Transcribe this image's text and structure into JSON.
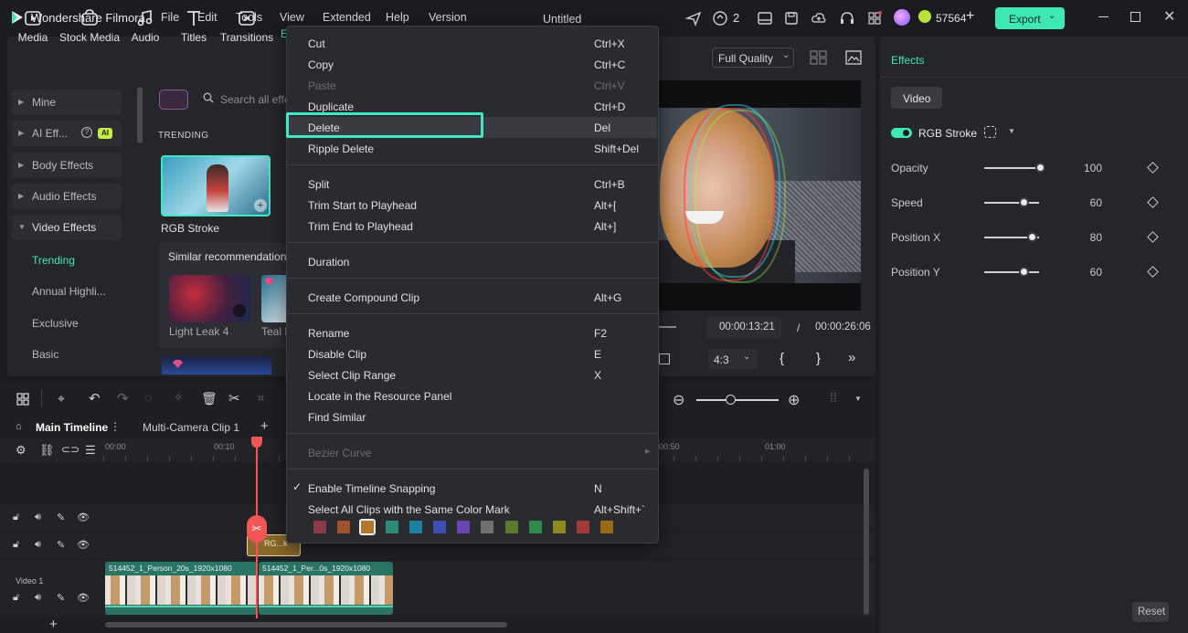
{
  "app": {
    "name": "Wondershare Filmora",
    "project_title": "Untitled",
    "menus": [
      "File",
      "Edit",
      "Tools",
      "View",
      "Extended",
      "Help",
      "Version"
    ],
    "notifications_count": "2",
    "credits": "57564",
    "export_label": "Export"
  },
  "toolbar": {
    "tabs": [
      "Media",
      "Stock Media",
      "Audio",
      "Titles",
      "Transitions",
      "E"
    ]
  },
  "sidebar": {
    "categories": [
      {
        "label": "Mine"
      },
      {
        "label": "AI Eff...",
        "badge": "AI"
      },
      {
        "label": "Body Effects"
      },
      {
        "label": "Audio Effects"
      },
      {
        "label": "Video Effects"
      }
    ],
    "subitems": [
      "Trending",
      "Annual Highli...",
      "Exclusive",
      "Basic"
    ]
  },
  "library": {
    "search_placeholder": "Search all effe",
    "section_title": "TRENDING",
    "featured_label": "RGB Stroke",
    "similar_title": "Similar recommendations",
    "similar_items": [
      "Light Leak 4",
      "Teal F"
    ]
  },
  "preview": {
    "quality": "Full Quality",
    "current_time": "00:00:13:21",
    "separator": "/",
    "total_time": "00:00:26:06",
    "aspect": "4:3"
  },
  "effects_panel": {
    "title": "Effects",
    "tab": "Video",
    "effect_name": "RGB Stroke",
    "params": [
      {
        "label": "Opacity",
        "value": "100",
        "fraction": 1.0
      },
      {
        "label": "Speed",
        "value": "60",
        "fraction": 0.6
      },
      {
        "label": "Position X",
        "value": "80",
        "fraction": 0.8
      },
      {
        "label": "Position Y",
        "value": "60",
        "fraction": 0.6
      }
    ],
    "reset_label": "Reset"
  },
  "timeline": {
    "tabs": [
      "Main Timeline",
      "Multi-Camera Clip 1"
    ],
    "ruler": [
      "00:00",
      "00:10",
      "00:50",
      "01:00"
    ],
    "track_label": "Video 1",
    "effect_clip": "RG...k",
    "clips": [
      "514452_1_Person_20s_1920x1080",
      "514452_1_Per...0s_1920x1080"
    ]
  },
  "context_menu": {
    "groups": [
      [
        {
          "label": "Cut",
          "shortcut": "Ctrl+X"
        },
        {
          "label": "Copy",
          "shortcut": "Ctrl+C"
        },
        {
          "label": "Paste",
          "shortcut": "Ctrl+V",
          "disabled": true
        },
        {
          "label": "Duplicate",
          "shortcut": "Ctrl+D"
        },
        {
          "label": "Delete",
          "shortcut": "Del",
          "highlighted": true
        },
        {
          "label": "Ripple Delete",
          "shortcut": "Shift+Del"
        }
      ],
      [
        {
          "label": "Split",
          "shortcut": "Ctrl+B"
        },
        {
          "label": "Trim Start to Playhead",
          "shortcut": "Alt+["
        },
        {
          "label": "Trim End to Playhead",
          "shortcut": "Alt+]"
        }
      ],
      [
        {
          "label": "Duration",
          "shortcut": ""
        }
      ],
      [
        {
          "label": "Create Compound Clip",
          "shortcut": "Alt+G"
        }
      ],
      [
        {
          "label": "Rename",
          "shortcut": "F2"
        },
        {
          "label": "Disable Clip",
          "shortcut": "E"
        },
        {
          "label": "Select Clip Range",
          "shortcut": "X"
        },
        {
          "label": "Locate in the Resource Panel",
          "shortcut": ""
        },
        {
          "label": "Find Similar",
          "shortcut": ""
        }
      ],
      [
        {
          "label": "Bezier Curve",
          "shortcut": "",
          "disabled": true,
          "submenu": true
        }
      ],
      [
        {
          "label": "Enable Timeline Snapping",
          "shortcut": "N",
          "checked": true
        },
        {
          "label": "Select All Clips with the Same Color Mark",
          "shortcut": "Alt+Shift+`"
        }
      ]
    ],
    "color_marks": [
      "#8a3b4a",
      "#a0522d",
      "#b07a2a",
      "#2e8b7a",
      "#1e7fa0",
      "#3c4fb0",
      "#6a44b0",
      "#707070",
      "#5a7a2e",
      "#2e8b4a",
      "#8f8a20",
      "#a33a3a",
      "#9a6a18"
    ],
    "selected_mark": 2
  },
  "colors": {
    "accent": "#3ee8b5",
    "highlight_box": "#3ee8c5"
  }
}
